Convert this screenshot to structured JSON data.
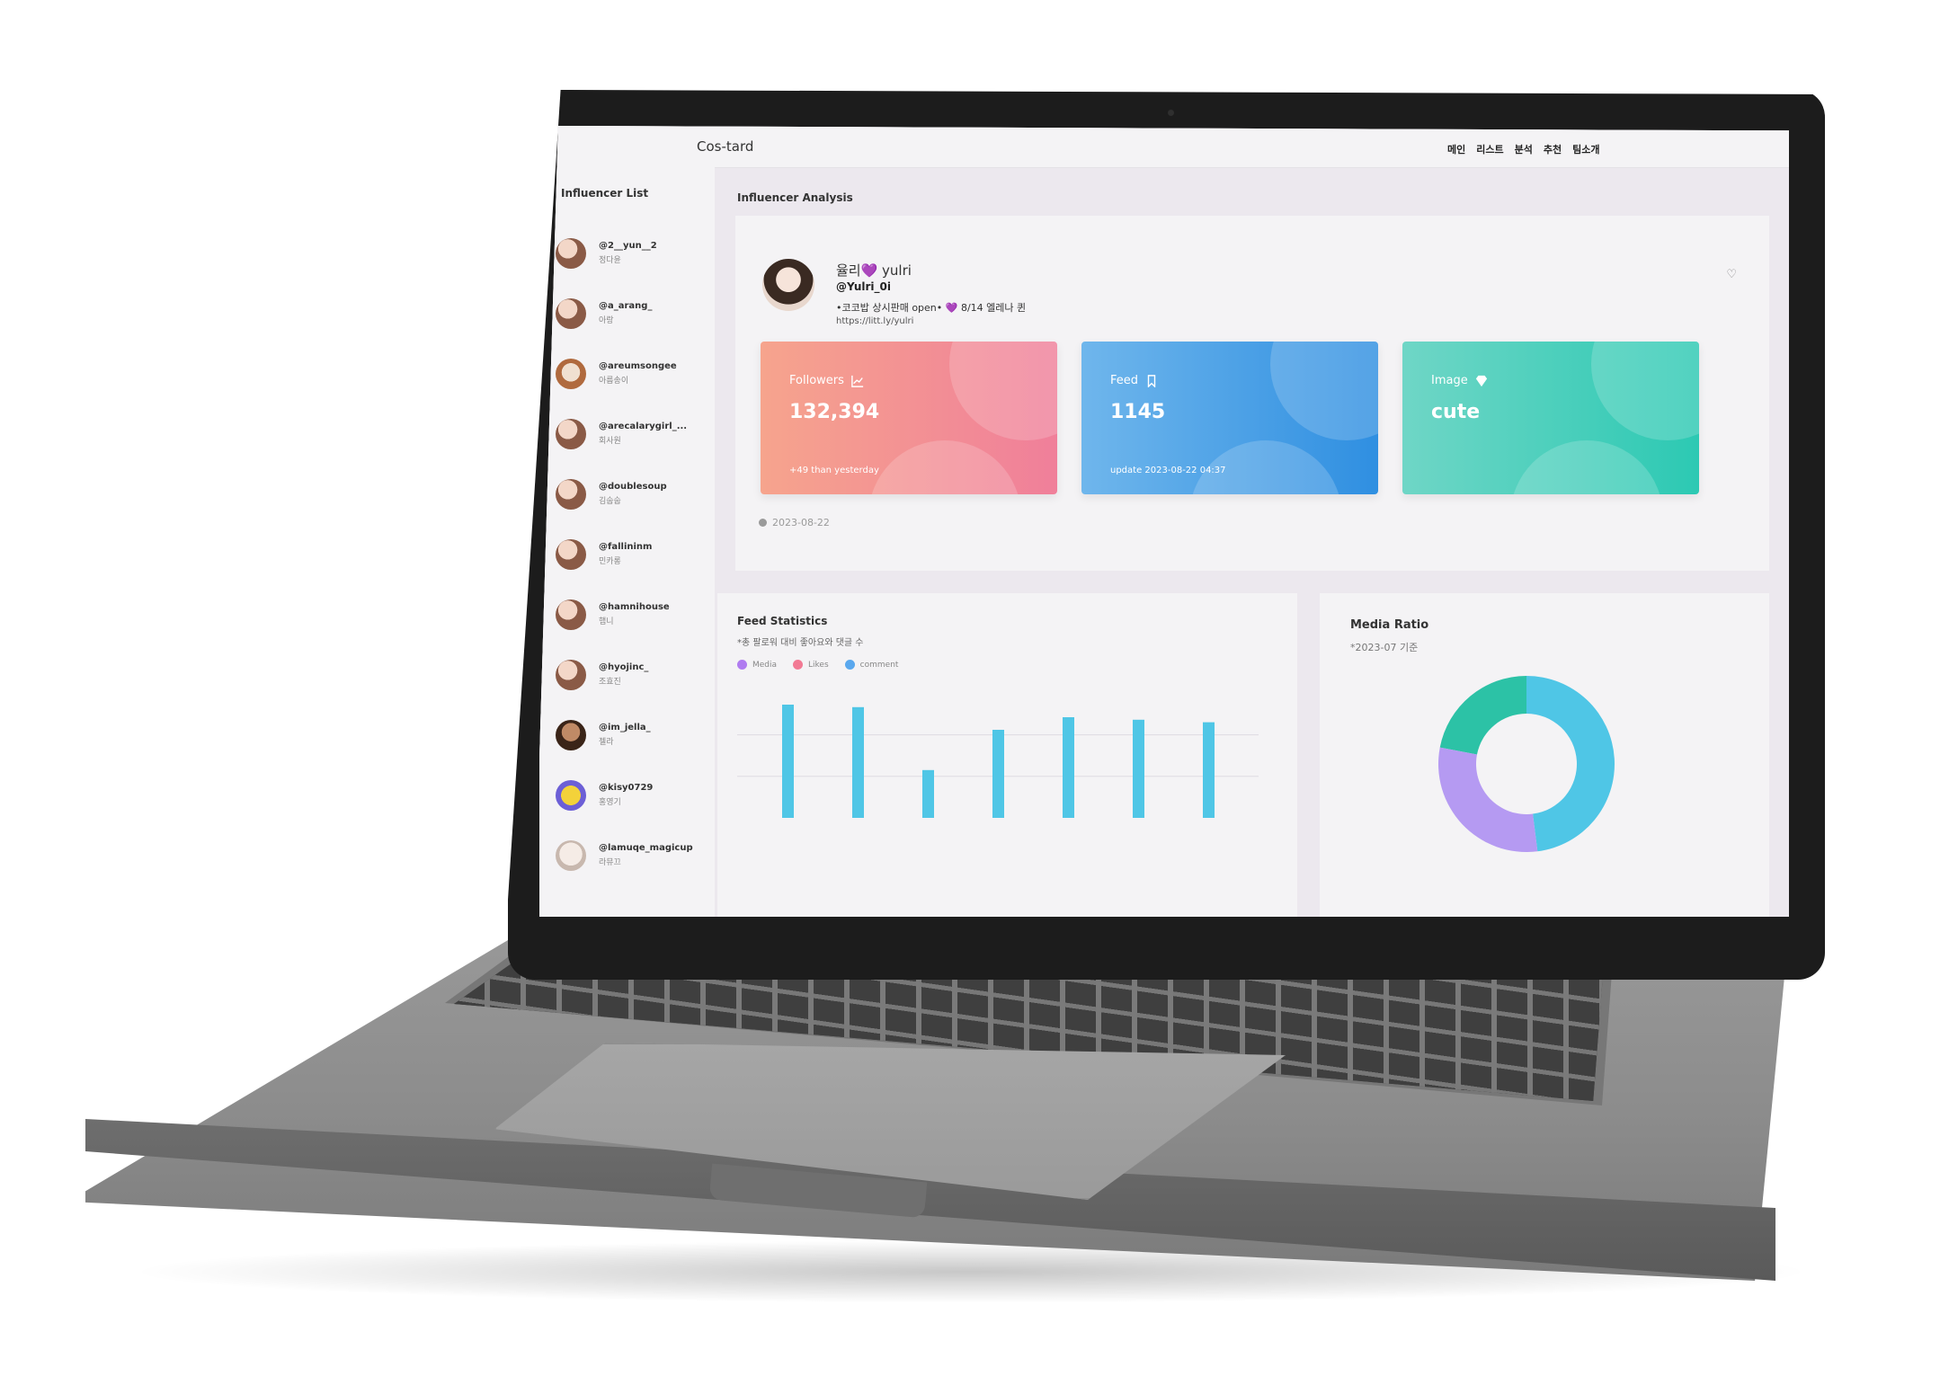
{
  "app": {
    "brand": "Cos-tard",
    "nav": [
      "메인",
      "리스트",
      "분석",
      "추천",
      "팀소개"
    ]
  },
  "sidebar": {
    "title": "Influencer List",
    "items": [
      {
        "handle": "@2__yun__2",
        "name": "정다윤"
      },
      {
        "handle": "@a_arang_",
        "name": "아랑"
      },
      {
        "handle": "@areumsongee",
        "name": "아름송이"
      },
      {
        "handle": "@arecalarygirl_...",
        "name": "회사원"
      },
      {
        "handle": "@doublesoup",
        "name": "김숩숩"
      },
      {
        "handle": "@fallininm",
        "name": "민카롱"
      },
      {
        "handle": "@hamnihouse",
        "name": "햄니"
      },
      {
        "handle": "@hyojinc_",
        "name": "조효진"
      },
      {
        "handle": "@im_jella_",
        "name": "젤라"
      },
      {
        "handle": "@kisy0729",
        "name": "홍영기"
      },
      {
        "handle": "@lamuqe_magicup",
        "name": "라뮤끄"
      }
    ]
  },
  "main": {
    "title": "Influencer Analysis",
    "profile": {
      "name": "율리💜 yulri",
      "handle": "@Yulri_0i",
      "bio": "•코코밥 상시판매 open• 💜 8/14 엘레나 퀸",
      "link": "https://litt.ly/yulri"
    },
    "cards": {
      "followers": {
        "label": "Followers",
        "value": "132,394",
        "sub": "+49 than yesterday",
        "icon": "trend-chart-icon"
      },
      "feed": {
        "label": "Feed",
        "value": "1145",
        "sub": "update 2023-08-22 04:37",
        "icon": "bookmark-icon"
      },
      "image": {
        "label": "Image",
        "value": "cute",
        "sub": "",
        "icon": "diamond-icon"
      }
    },
    "date": "2023-08-22"
  },
  "feed_stats": {
    "title": "Feed Statistics",
    "subtitle": "*총 팔로워 대비 좋아요와 댓글 수",
    "legend": [
      "Media",
      "Likes",
      "comment"
    ]
  },
  "media_ratio": {
    "title": "Media Ratio",
    "subtitle": "*2023-07 기준"
  },
  "colors": {
    "accent_cyan": "#4fc6e6",
    "legend_media": "#b07cf0",
    "legend_likes": "#f27a94",
    "legend_comment": "#5aa8ee",
    "donut_teal": "#2cc2a6",
    "donut_blue": "#4fc6e6",
    "donut_purple": "#b59af2"
  },
  "chart_data": [
    {
      "type": "bar",
      "title": "Feed Statistics",
      "series": [
        {
          "name": "Media",
          "values": [
            90,
            88,
            38,
            70,
            80,
            78,
            76
          ]
        }
      ],
      "ylim": [
        0,
        100
      ]
    },
    {
      "type": "pie",
      "title": "Media Ratio",
      "slices": [
        {
          "label": "teal",
          "value": 22
        },
        {
          "label": "blue",
          "value": 48
        },
        {
          "label": "purple",
          "value": 30
        }
      ]
    }
  ]
}
